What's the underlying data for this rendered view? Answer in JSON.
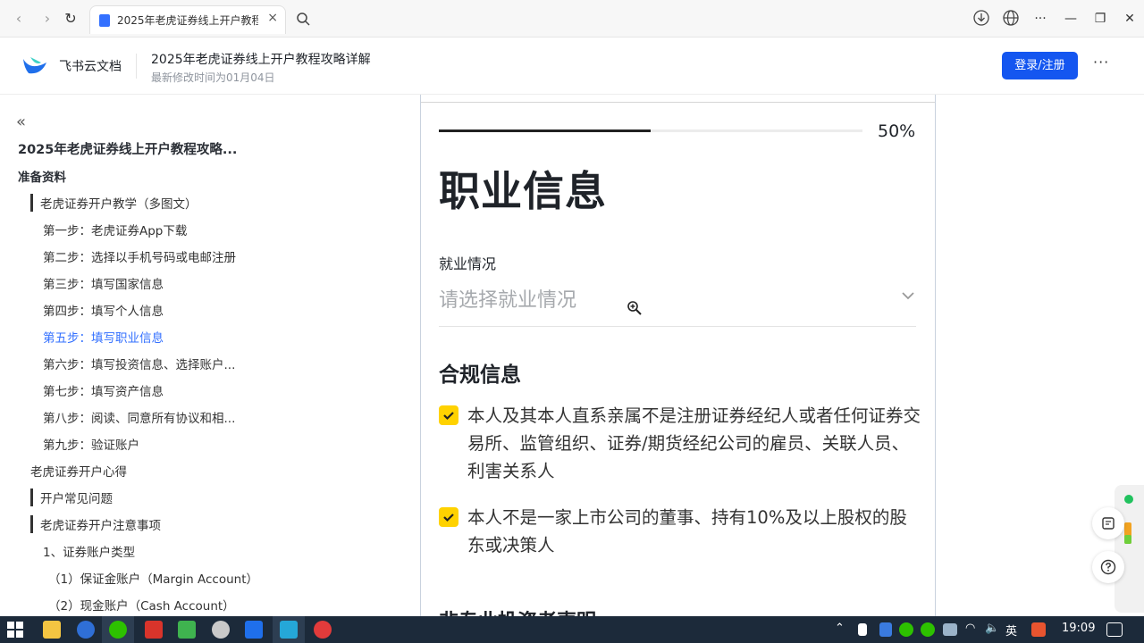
{
  "browser": {
    "tab_title": "2025年老虎证券线上开户教程",
    "tab_close": "×"
  },
  "header": {
    "brand": "飞书云文档",
    "doc_title": "2025年老虎证券线上开户教程攻略详解",
    "doc_meta": "最新修改时间为01月04日",
    "login_label": "登录/注册",
    "more_label": "···"
  },
  "sidebar": {
    "collapse": "«",
    "items": [
      {
        "label": "2025年老虎证券线上开户教程攻略..."
      },
      {
        "label": "准备资料"
      },
      {
        "label": "老虎证券开户教学（多图文）"
      },
      {
        "label": "第一步：老虎证券App下载"
      },
      {
        "label": "第二步：选择以手机号码或电邮注册"
      },
      {
        "label": "第三步：填写国家信息"
      },
      {
        "label": "第四步：填写个人信息"
      },
      {
        "label": "第五步：填写职业信息"
      },
      {
        "label": "第六步：填写投资信息、选择账户..."
      },
      {
        "label": "第七步：填写资产信息"
      },
      {
        "label": "第八步：阅读、同意所有协议和相..."
      },
      {
        "label": "第九步：验证账户"
      },
      {
        "label": "老虎证券开户心得"
      },
      {
        "label": "开户常见问题"
      },
      {
        "label": "老虎证券开户注意事项"
      },
      {
        "label": "1、证券账户类型"
      },
      {
        "label": "（1）保证金账户（Margin Account）"
      },
      {
        "label": "（2）现金账户（Cash Account）"
      }
    ]
  },
  "doc": {
    "progress_percent": 50,
    "progress_text": "50%",
    "heading": "职业信息",
    "employment_label": "就业情况",
    "employment_placeholder": "请选择就业情况",
    "compliance_heading": "合规信息",
    "checks": [
      {
        "text": "本人及其本人直系亲属不是注册证券经纪人或者任何证券交易所、监管组织、证券/期货经纪公司的雇员、关联人员、利害关系人",
        "checked": true
      },
      {
        "text": "本人不是一家上市公司的董事、持有10%及以上股权的股东或决策人",
        "checked": true
      }
    ],
    "next_heading": "非专业投资者声明"
  },
  "colors": {
    "accent": "#1456f0",
    "checkbox": "#ffd200",
    "active_link": "#3370ff"
  },
  "taskbar": {
    "ime": "英",
    "time": "19:09"
  }
}
